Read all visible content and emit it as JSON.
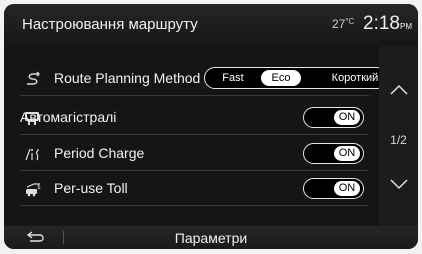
{
  "header": {
    "title": "Настроювання маршруту",
    "temperature": "27",
    "temperature_unit": "°C",
    "time": "2:18",
    "ampm": "PM"
  },
  "rows": [
    {
      "label": "Route Planning Method",
      "icon": "route-icon",
      "segments": [
        "Fast",
        "Eco",
        "Короткий"
      ],
      "selected": "Eco"
    },
    {
      "label": "Автомагістралі",
      "icon": "highway-icon",
      "state": "ON"
    },
    {
      "label": "Period Charge",
      "icon": "period-charge-icon",
      "state": "ON"
    },
    {
      "label": "Per-use Toll",
      "icon": "toll-icon",
      "state": "ON"
    }
  ],
  "pager": "1/2",
  "bottom": {
    "title": "Параметри"
  }
}
